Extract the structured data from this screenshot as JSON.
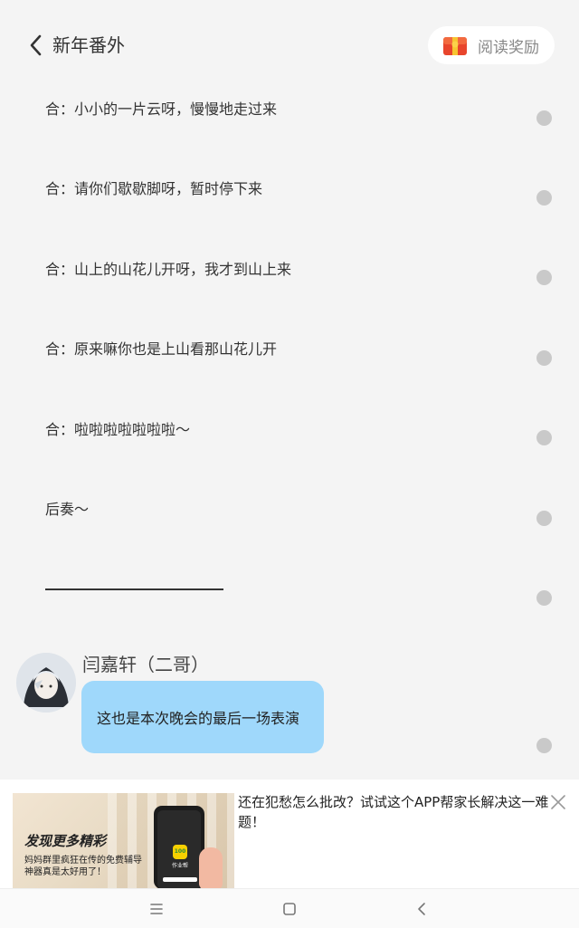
{
  "header": {
    "title": "新年番外",
    "reward_label": "阅读奖励"
  },
  "lines": [
    {
      "text": "合：小小的一片云呀，慢慢地走过来"
    },
    {
      "text": "合：请你们歇歇脚呀，暂时停下来"
    },
    {
      "text": "合：山上的山花儿开呀，我才到山上来"
    },
    {
      "text": "合：原来嘛你也是上山看那山花儿开"
    },
    {
      "text": "合：啦啦啦啦啦啦啦～"
    },
    {
      "text": "后奏～"
    }
  ],
  "message": {
    "sender": "闫嘉轩（二哥）",
    "text": "这也是本次晚会的最后一场表演"
  },
  "ad": {
    "headline": "发现更多精彩",
    "subline": "妈妈群里疯狂在传的免费辅导神器真是太好用了！",
    "app_icon_text": "100",
    "app_name": "作业帮",
    "text": "还在犯愁怎么批改？试试这个APP帮家长解决这一难题！"
  },
  "colors": {
    "background": "#f4f4f4",
    "bubble": "#9fd8fb",
    "dot": "#c9c9c9"
  },
  "icons": [
    "back-arrow-icon",
    "gift-box-icon",
    "comment-dot-icon",
    "close-icon",
    "menu-icon",
    "home-icon",
    "nav-back-icon"
  ]
}
